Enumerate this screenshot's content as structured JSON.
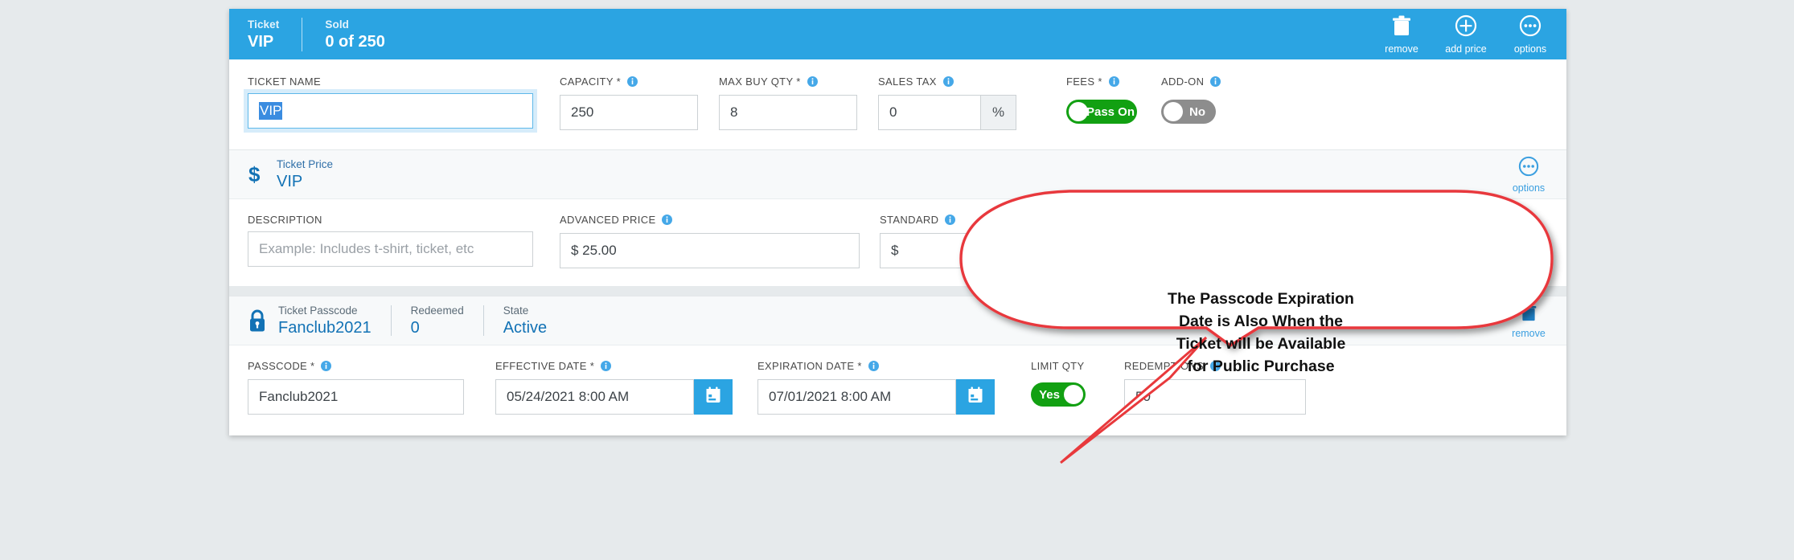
{
  "ticket_header": {
    "ticket_label": "Ticket",
    "ticket_value": "VIP",
    "sold_label": "Sold",
    "sold_value": "0 of 250",
    "actions": [
      {
        "name": "remove",
        "label": "remove",
        "icon": "trash-icon"
      },
      {
        "name": "add-price",
        "label": "add price",
        "icon": "plus-circle-icon"
      },
      {
        "name": "options",
        "label": "options",
        "icon": "ellipsis-circle-icon"
      }
    ],
    "accent_color": "#2ba4e2"
  },
  "ticket_fields": {
    "ticket_name": {
      "label": "TICKET NAME",
      "value": "VIP",
      "selected": true,
      "focused": true
    },
    "capacity": {
      "label": "CAPACITY",
      "required": "*",
      "info": true,
      "value": "250"
    },
    "max_buy_qty": {
      "label": "MAX BUY QTY",
      "required": "*",
      "info": true,
      "value": "8"
    },
    "sales_tax": {
      "label": "SALES TAX",
      "info": true,
      "value": "0",
      "suffix": "%"
    },
    "fees": {
      "label": "FEES",
      "required": "*",
      "info": true,
      "toggle_label": "Pass On",
      "toggle_state": "on",
      "toggle_color": "#12a012",
      "knob_side": "left"
    },
    "add_on": {
      "label": "ADD-ON",
      "info": true,
      "toggle_label": "No",
      "toggle_state": "off",
      "toggle_color": "#8d8d8d",
      "knob_side": "left"
    }
  },
  "price_section": {
    "icon": "dollar-icon",
    "header_label": "Ticket Price",
    "header_value": "VIP",
    "options_label": "options",
    "description": {
      "label": "DESCRIPTION",
      "placeholder": "Example: Includes t-shirt, ticket, etc",
      "value": ""
    },
    "advanced_price": {
      "label": "ADVANCED PRICE",
      "info": true,
      "value": "$ 25.00"
    },
    "standard_price": {
      "label": "STANDARD",
      "info": true,
      "value": "$"
    }
  },
  "passcode_section": {
    "icon": "lock-icon",
    "header": {
      "passcode_label": "Ticket Passcode",
      "passcode_value": "Fanclub2021",
      "redeemed_label": "Redeemed",
      "redeemed_value": "0",
      "state_label": "State",
      "state_value": "Active",
      "remove_label": "remove"
    },
    "passcode": {
      "label": "PASSCODE",
      "required": "*",
      "info": true,
      "value": "Fanclub2021"
    },
    "effective_date": {
      "label": "EFFECTIVE DATE",
      "required": "*",
      "info": true,
      "value": "05/24/2021 8:00 AM",
      "icon": "calendar-icon"
    },
    "expiration_date": {
      "label": "EXPIRATION DATE",
      "required": "*",
      "info": true,
      "value": "07/01/2021 8:00 AM",
      "icon": "calendar-icon"
    },
    "limit_qty": {
      "label": "LIMIT QTY",
      "toggle_label": "Yes",
      "toggle_state": "on",
      "toggle_color": "#12a012",
      "knob_side": "right"
    },
    "redemptions": {
      "label": "REDEMPTIONS",
      "info": true,
      "value": "50"
    }
  },
  "callout": {
    "text": "The Passcode Expiration Date is Also When the Ticket will be Available for Public Purchase",
    "line1": "The Passcode Expiration",
    "line2": "Date is Also When the",
    "line3": "Ticket will be Available",
    "line4": "for Public Purchase",
    "border_color": "#e8393c",
    "fill_color": "#ffffff"
  }
}
